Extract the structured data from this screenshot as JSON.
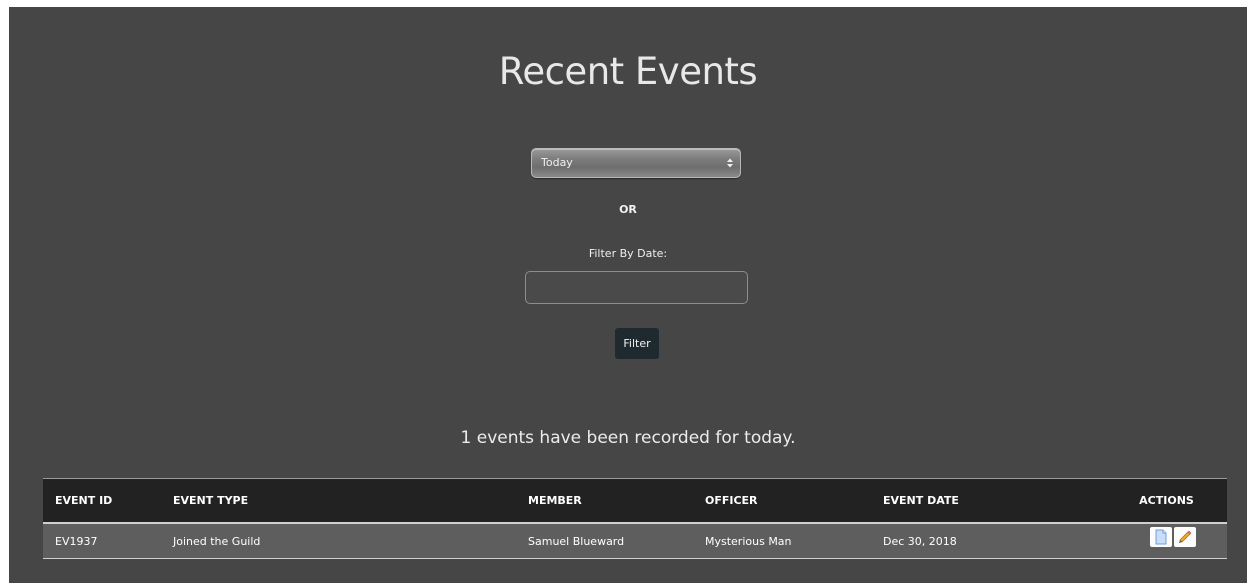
{
  "page": {
    "title": "Recent Events"
  },
  "filters": {
    "range_select_value": "Today",
    "range_select_options": [
      "Today"
    ],
    "or_label": "OR",
    "date_label": "Filter By Date:",
    "date_value": "",
    "date_placeholder": "",
    "filter_button_label": "Filter"
  },
  "summary": "1 events have been recorded for today.",
  "table": {
    "headers": {
      "event_id": "EVENT ID",
      "event_type": "EVENT TYPE",
      "member": "MEMBER",
      "officer": "OFFICER",
      "event_date": "EVENT DATE",
      "actions": "ACTIONS"
    },
    "rows": [
      {
        "event_id": "EV1937",
        "event_type": "Joined the Guild",
        "member": "Samuel Blueward",
        "officer": "Mysterious Man",
        "event_date": "Dec 30, 2018",
        "actions": [
          "view-document-icon",
          "edit-pencil-icon"
        ]
      }
    ]
  },
  "colors": {
    "panel_background": "#464646",
    "table_header_background": "#222222",
    "table_row_background": "#5e5e5e",
    "filter_button_background": "#1f2a30",
    "text": "#ececec"
  }
}
